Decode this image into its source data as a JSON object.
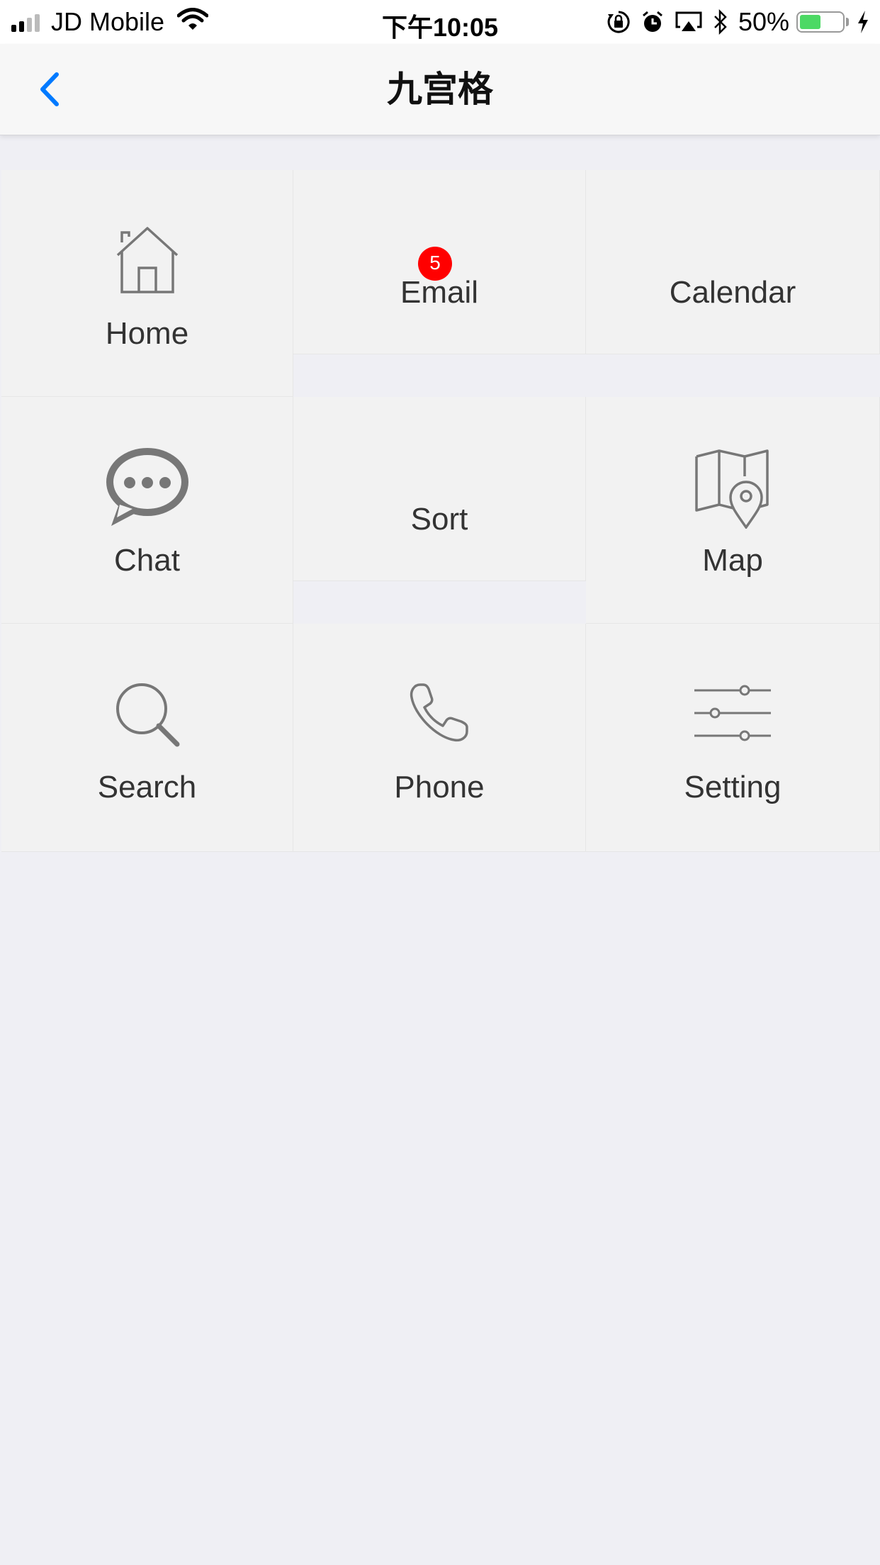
{
  "status_bar": {
    "carrier": "JD Mobile",
    "time": "下午10:05",
    "battery_percent": "50%",
    "battery_level": 0.5,
    "signal_bars_filled": 2
  },
  "nav": {
    "title": "九宫格",
    "back_icon": "chevron-left-icon",
    "accent_color": "#007aff"
  },
  "grid": {
    "items": [
      {
        "label": "Home",
        "icon": "home-icon"
      },
      {
        "label": "Email",
        "icon": "",
        "badge": "5"
      },
      {
        "label": "Calendar",
        "icon": ""
      },
      {
        "label": "Chat",
        "icon": "chat-bubble-icon"
      },
      {
        "label": "Sort",
        "icon": ""
      },
      {
        "label": "Map",
        "icon": "map-pin-icon"
      },
      {
        "label": "Search",
        "icon": "search-icon"
      },
      {
        "label": "Phone",
        "icon": "phone-icon"
      },
      {
        "label": "Setting",
        "icon": "sliders-icon"
      }
    ],
    "badge_color": "#ff0000"
  }
}
